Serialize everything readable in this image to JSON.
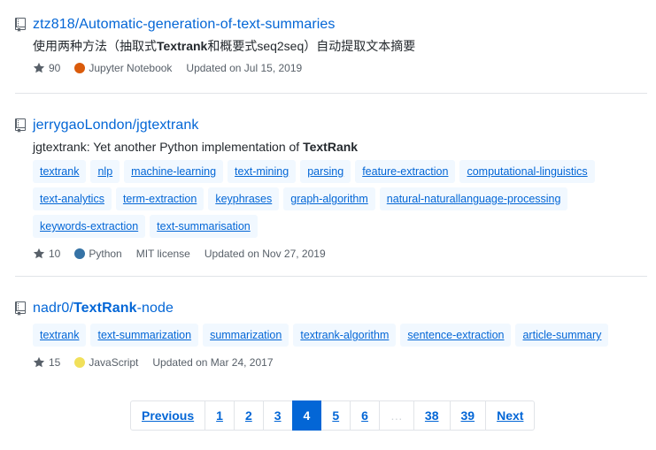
{
  "repos": [
    {
      "link_prefix": "ztz818/Automatic-generation-of-text-summaries",
      "link_bold": "",
      "link_suffix": "",
      "desc_pre": "使用两种方法（抽取式",
      "desc_bold": "Textrank",
      "desc_post": "和概要式seq2seq）自动提取文本摘要",
      "topics": [],
      "stars": "90",
      "language": "Jupyter Notebook",
      "language_color": "#DA5B0B",
      "license": "",
      "updated": "Updated on Jul 15, 2019"
    },
    {
      "link_prefix": "jerrygaoLondon/jgtextrank",
      "link_bold": "",
      "link_suffix": "",
      "desc_pre": "jgtextrank: Yet another Python implementation of ",
      "desc_bold": "TextRank",
      "desc_post": "",
      "topics": [
        "textrank",
        "nlp",
        "machine-learning",
        "text-mining",
        "parsing",
        "feature-extraction",
        "computational-linguistics",
        "text-analytics",
        "term-extraction",
        "keyphrases",
        "graph-algorithm",
        "natural-naturallanguage-processing",
        "keywords-extraction",
        "text-summarisation"
      ],
      "stars": "10",
      "language": "Python",
      "language_color": "#3572A5",
      "license": "MIT license",
      "updated": "Updated on Nov 27, 2019"
    },
    {
      "link_prefix": "nadr0/",
      "link_bold": "TextRank",
      "link_suffix": "-node",
      "desc_pre": "",
      "desc_bold": "",
      "desc_post": "",
      "topics": [
        "textrank",
        "text-summarization",
        "summarization",
        "textrank-algorithm",
        "sentence-extraction",
        "article-summary"
      ],
      "stars": "15",
      "language": "JavaScript",
      "language_color": "#F1E05A",
      "license": "",
      "updated": "Updated on Mar 24, 2017"
    }
  ],
  "pagination": {
    "previous": "Previous",
    "pages": [
      "1",
      "2",
      "3",
      "4",
      "5",
      "6",
      "…",
      "38",
      "39"
    ],
    "current": "4",
    "next": "Next"
  },
  "icons": {
    "repo": "repo-icon",
    "star": "star-icon"
  },
  "colors": {
    "link": "#0366d6",
    "topic_bg": "#f1f8ff",
    "current_page_bg": "#0366d6"
  }
}
